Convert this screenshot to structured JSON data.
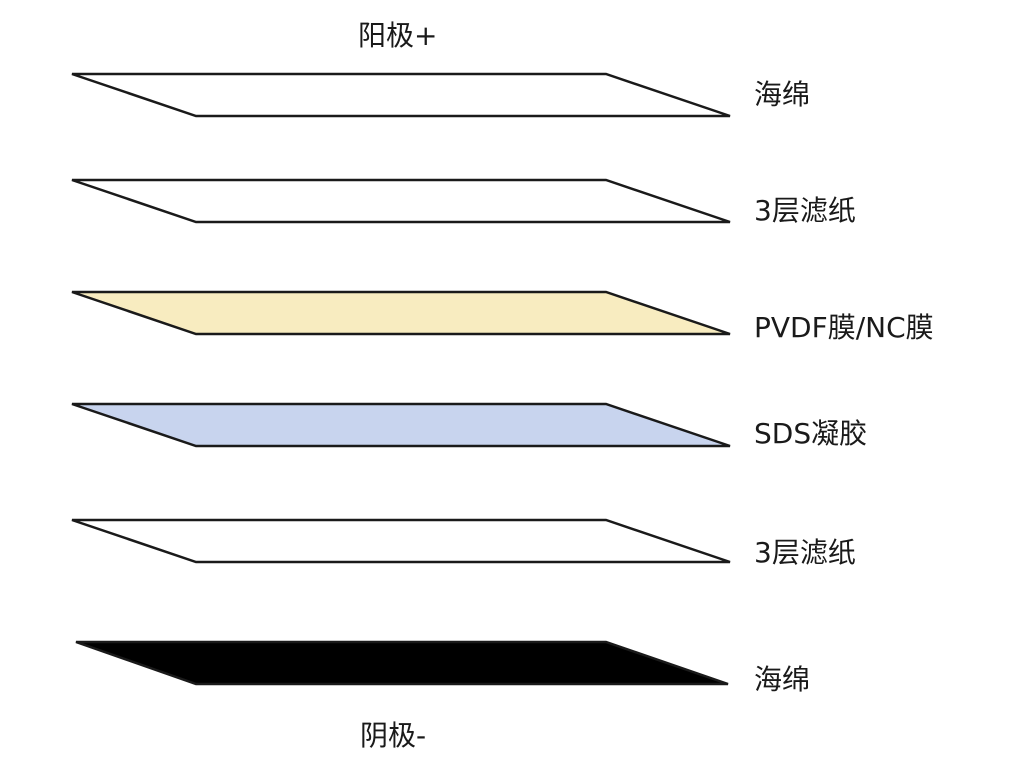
{
  "diagram": {
    "anode_label": "阳极+",
    "cathode_label": "阴极-",
    "layers": [
      {
        "label": "海绵",
        "fill": "#ffffff"
      },
      {
        "label": "3层滤纸",
        "fill": "#ffffff"
      },
      {
        "label": "PVDF膜/NC膜",
        "fill": "#f8ecc0"
      },
      {
        "label": "SDS凝胶",
        "fill": "#c8d4ee"
      },
      {
        "label": "3层滤纸",
        "fill": "#ffffff"
      },
      {
        "label": "海绵",
        "fill": "#000000"
      }
    ],
    "outline_color": "#1a1a1a"
  }
}
